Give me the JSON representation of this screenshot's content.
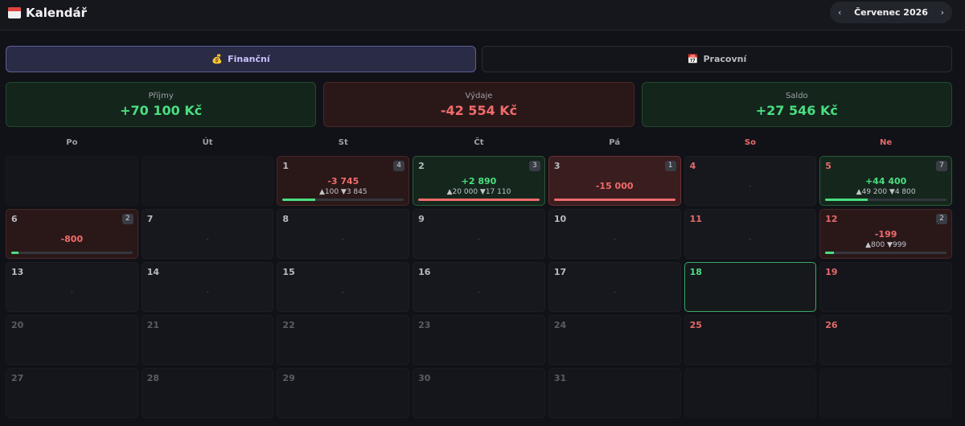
{
  "app": {
    "title": "Kalendář"
  },
  "month_nav": {
    "prev": "‹",
    "label": "Červenec 2026",
    "next": "›"
  },
  "tabs": [
    {
      "label": "Finanční",
      "icon": "money-bag-icon",
      "glyph": "💰",
      "active": true
    },
    {
      "label": "Pracovní",
      "icon": "calendar-icon",
      "glyph": "📅",
      "active": false
    }
  ],
  "summary": [
    {
      "label": "Příjmy",
      "value": "+70 100 Kč",
      "tone": "income",
      "color": "#4ade80"
    },
    {
      "label": "Výdaje",
      "value": "-42 554 Kč",
      "tone": "expense",
      "color": "#f26b6b"
    },
    {
      "label": "Saldo",
      "value": "+27 546 Kč",
      "tone": "balance",
      "color": "#4ade80"
    }
  ],
  "weekdays": [
    {
      "label": "Po",
      "weekend": false
    },
    {
      "label": "Út",
      "weekend": false
    },
    {
      "label": "St",
      "weekend": false
    },
    {
      "label": "Čt",
      "weekend": false
    },
    {
      "label": "Pá",
      "weekend": false
    },
    {
      "label": "So",
      "weekend": true
    },
    {
      "label": "Ne",
      "weekend": true
    }
  ],
  "days": [
    {
      "day": "",
      "kind": "empty"
    },
    {
      "day": "",
      "kind": "empty"
    },
    {
      "day": "1",
      "kind": "neg",
      "count": "4",
      "amount": "-3 745",
      "sign": "neg",
      "split": "▲100 ▼3 845",
      "bar": 0.27,
      "barColor": "green"
    },
    {
      "day": "2",
      "kind": "pos",
      "count": "3",
      "amount": "+2 890",
      "sign": "pos",
      "split": "▲20 000 ▼17 110",
      "bar": 1.0,
      "barColor": "red"
    },
    {
      "day": "3",
      "kind": "negstrong",
      "count": "1",
      "amount": "-15 000",
      "sign": "neg",
      "bar": 1.0,
      "barColor": "red"
    },
    {
      "day": "4",
      "kind": "normal",
      "weekend": true,
      "dash": "-"
    },
    {
      "day": "5",
      "kind": "pos",
      "weekend": true,
      "count": "7",
      "amount": "+44 400",
      "sign": "pos",
      "split": "▲49 200 ▼4 800",
      "bar": 0.35,
      "barColor": "green"
    },
    {
      "day": "6",
      "kind": "neg",
      "count": "2",
      "amount": "-800",
      "sign": "neg",
      "bar": 0.06,
      "barColor": "green"
    },
    {
      "day": "7",
      "kind": "normal",
      "dash": "-"
    },
    {
      "day": "8",
      "kind": "normal",
      "dash": "-"
    },
    {
      "day": "9",
      "kind": "normal",
      "dash": "-"
    },
    {
      "day": "10",
      "kind": "normal",
      "dash": "-"
    },
    {
      "day": "11",
      "kind": "normal",
      "weekend": true,
      "dash": "-"
    },
    {
      "day": "12",
      "kind": "neg",
      "weekend": true,
      "count": "2",
      "amount": "-199",
      "sign": "neg",
      "split": "▲800 ▼999",
      "bar": 0.07,
      "barColor": "green"
    },
    {
      "day": "13",
      "kind": "normal",
      "dash": "-"
    },
    {
      "day": "14",
      "kind": "normal",
      "dash": "-"
    },
    {
      "day": "15",
      "kind": "normal",
      "dash": "-"
    },
    {
      "day": "16",
      "kind": "normal",
      "dash": "-"
    },
    {
      "day": "17",
      "kind": "normal",
      "dash": "-"
    },
    {
      "day": "18",
      "kind": "today",
      "weekend": true
    },
    {
      "day": "19",
      "kind": "next",
      "weekend": true
    },
    {
      "day": "20",
      "kind": "next",
      "faded": true
    },
    {
      "day": "21",
      "kind": "next",
      "faded": true
    },
    {
      "day": "22",
      "kind": "next",
      "faded": true
    },
    {
      "day": "23",
      "kind": "next",
      "faded": true
    },
    {
      "day": "24",
      "kind": "next",
      "faded": true
    },
    {
      "day": "25",
      "kind": "next",
      "weekend": true
    },
    {
      "day": "26",
      "kind": "next",
      "weekend": true
    },
    {
      "day": "27",
      "kind": "next",
      "faded": true
    },
    {
      "day": "28",
      "kind": "next",
      "faded": true
    },
    {
      "day": "29",
      "kind": "next",
      "faded": true
    },
    {
      "day": "30",
      "kind": "next",
      "faded": true
    },
    {
      "day": "31",
      "kind": "next",
      "faded": true
    },
    {
      "day": "",
      "kind": "empty"
    },
    {
      "day": "",
      "kind": "empty"
    }
  ]
}
